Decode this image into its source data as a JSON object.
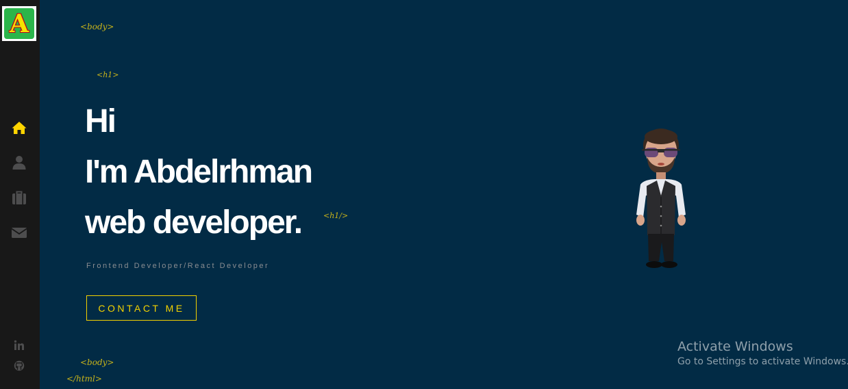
{
  "brand": {
    "logo_letter": "A"
  },
  "colors": {
    "background": "#022b45",
    "sidebar": "#181818",
    "accent": "#f5d300",
    "tag": "#c9b41a",
    "nav_active": "#ffd400",
    "nav_inactive": "#4d4d4e"
  },
  "sidebar": {
    "nav": [
      {
        "icon": "home-icon",
        "active": true
      },
      {
        "icon": "user-icon",
        "active": false
      },
      {
        "icon": "briefcase-icon",
        "active": false
      },
      {
        "icon": "envelope-icon",
        "active": false
      }
    ],
    "social": [
      {
        "icon": "linkedin-icon"
      },
      {
        "icon": "github-icon"
      }
    ]
  },
  "tags": {
    "body_open": "<body>",
    "h1_open": "<h1>",
    "h1_close": "<h1/>",
    "body_close": "<body>",
    "html_close": "</html>"
  },
  "hero": {
    "line1": "Hi",
    "line2": "I'm Abdelrhman",
    "line3": "web developer.",
    "subtitle": "Frontend Developer/React Developer",
    "cta_label": "CONTACT ME"
  },
  "watermark": {
    "title": "Activate Windows",
    "subtitle": "Go to Settings to activate Windows."
  }
}
